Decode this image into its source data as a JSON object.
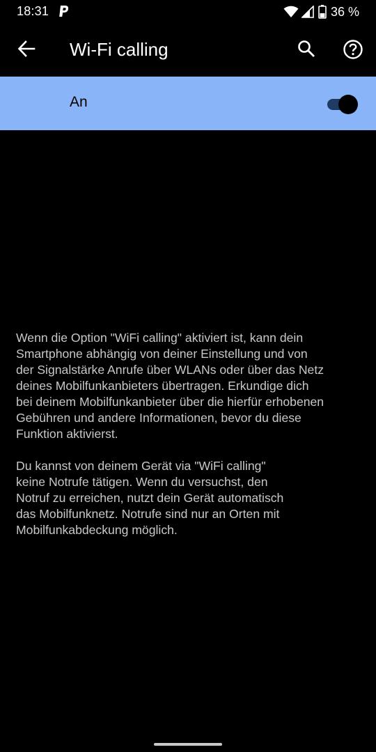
{
  "status_bar": {
    "time": "18:31",
    "battery_percent": "36 %",
    "icons": [
      "paypal-icon",
      "wifi-icon",
      "signal-icon",
      "battery-icon"
    ]
  },
  "app_bar": {
    "title": "Wi-Fi calling",
    "icons": [
      "arrow-back-icon",
      "search-icon",
      "help-icon"
    ]
  },
  "master_switch": {
    "label": "An",
    "checked": true,
    "background_color": "#8ab4f8"
  },
  "info": {
    "paragraph_1": "Wenn die Option \"WiFi calling\" aktiviert ist, kann dein\nSmartphone abhängig von deiner Einstellung und von\nder Signalstärke Anrufe über WLANs oder über das Netz\ndeines Mobilfunkanbieters übertragen. Erkundige dich\nbei deinem Mobilfunkanbieter über die hierfür erhobenen\nGebühren und andere Informationen, bevor du diese\nFunktion aktivierst.",
    "paragraph_2": "Du kannst von deinem Gerät via \"WiFi calling\"\nkeine Notrufe tätigen. Wenn du versuchst, den\nNotruf zu erreichen, nutzt dein Gerät automatisch\ndas Mobilfunknetz. Notrufe sind nur an Orten mit\nMobilfunkabdeckung möglich."
  }
}
